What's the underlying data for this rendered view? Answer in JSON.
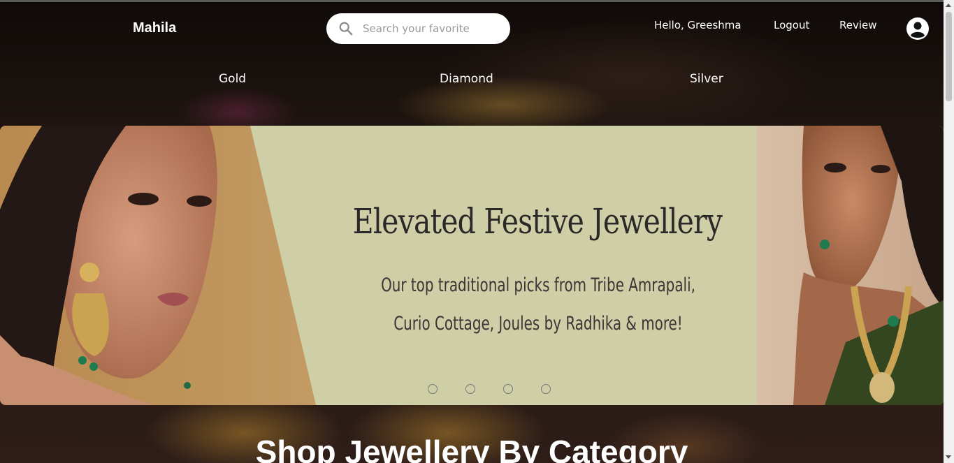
{
  "header": {
    "brand": "Mahila",
    "search": {
      "placeholder": "Search your favorite"
    },
    "greeting": "Hello, Greeshma",
    "logout": "Logout",
    "review": "Review"
  },
  "categories": [
    "Gold",
    "Diamond",
    "Silver"
  ],
  "banner": {
    "title": "Elevated Festive Jewellery",
    "subtitle_line1": "Our top traditional picks from Tribe Amrapali,",
    "subtitle_line2": "Curio Cottage, Joules by Radhika & more!",
    "slide_count": 4
  },
  "section": {
    "title": "Shop Jewellery By Category"
  },
  "colors": {
    "banner_bg": "#cfcfa7",
    "text_light": "#ffffff"
  },
  "icons": {
    "search": "search-icon",
    "account": "user-circle-icon"
  }
}
